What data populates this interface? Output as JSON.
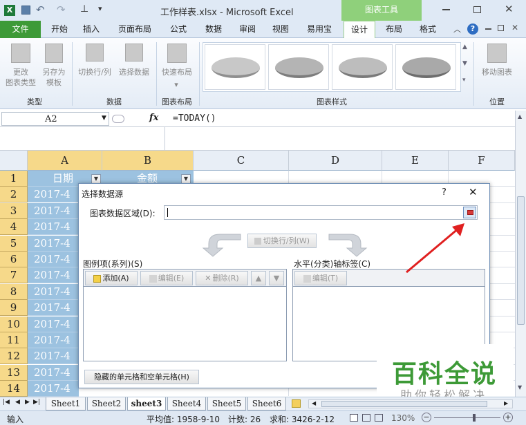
{
  "window": {
    "title": "工作样表.xlsx - Microsoft Excel",
    "context_tab_title": "图表工具"
  },
  "ribbon_tabs": [
    "文件",
    "开始",
    "插入",
    "页面布局",
    "公式",
    "数据",
    "审阅",
    "视图",
    "易用宝",
    "设计",
    "布局",
    "格式"
  ],
  "ribbon": {
    "groups": [
      {
        "label": "类型",
        "buttons": [
          "更改\n图表类型",
          "另存为\n模板"
        ]
      },
      {
        "label": "数据",
        "buttons": [
          "切换行/列",
          "选择数据"
        ]
      },
      {
        "label": "图表布局",
        "buttons": [
          "快速布局"
        ]
      },
      {
        "label": "图表样式",
        "buttons": []
      },
      {
        "label": "位置",
        "buttons": [
          "移动图表"
        ]
      }
    ]
  },
  "formula_bar": {
    "name_box": "A2",
    "fx": "fx",
    "formula": "=TODAY()"
  },
  "sheet": {
    "columns": [
      "A",
      "B",
      "C",
      "D",
      "E",
      "F"
    ],
    "header_row": {
      "a": "日期",
      "b": "金额"
    },
    "rows": [
      "1",
      "2",
      "3",
      "4",
      "5",
      "6",
      "7",
      "8",
      "9",
      "10",
      "11",
      "12",
      "13",
      "14"
    ],
    "a_values": [
      "2017-4",
      "2017-4",
      "2017-4",
      "2017-4",
      "2017-4",
      "2017-4",
      "2017-4",
      "2017-4",
      "2017-4",
      "2017-4",
      "2017-4",
      "2017-4",
      "2017-4"
    ]
  },
  "dialog": {
    "title": "选择数据源",
    "help": "?",
    "close": "✕",
    "range_label": "图表数据区域(D):",
    "range_value": "",
    "switch_button": "切换行/列(W)",
    "legend_label": "图例项(系列)(S)",
    "axis_label": "水平(分类)轴标签(C)",
    "add_button": "添加(A)",
    "edit_button": "编辑(E)",
    "delete_button": "删除(R)",
    "axis_edit_button": "编辑(T)",
    "hidden_cells_button": "隐藏的单元格和空单元格(H)"
  },
  "sheet_tabs": [
    "Sheet1",
    "Sheet2",
    "sheet3",
    "Sheet4",
    "Sheet5",
    "Sheet6"
  ],
  "active_sheet": "sheet3",
  "status": {
    "mode": "输入",
    "average": "平均值: 1958-9-10",
    "count": "计数: 26",
    "sum": "求和: 3426-2-12",
    "zoom": "130%"
  },
  "watermark": {
    "main": "百科全说",
    "sub": "助你轻松解决"
  },
  "colors": {
    "accent_green": "#3d9a37",
    "annotation_red": "#e02020"
  }
}
